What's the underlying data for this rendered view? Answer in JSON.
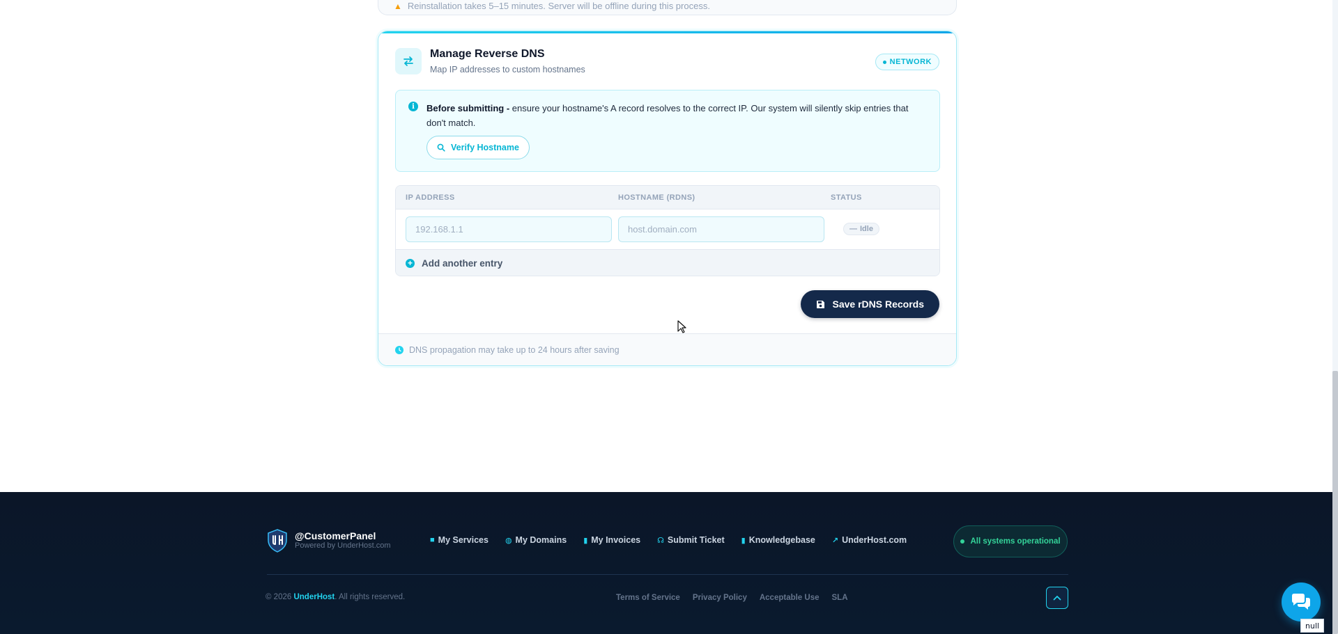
{
  "previous_card": {
    "warning_text": "Reinstallation takes 5–15 minutes. Server will be offline during this process."
  },
  "rdns_card": {
    "title": "Manage Reverse DNS",
    "subtitle": "Map IP addresses to custom hostnames",
    "badge": "NETWORK",
    "info": {
      "bold": "Before submitting -",
      "text": " ensure your hostname's A record resolves to the correct IP. Our system will silently skip entries that don't match.",
      "verify_button": "Verify Hostname"
    },
    "table": {
      "headers": [
        "IP ADDRESS",
        "HOSTNAME (RDNS)",
        "STATUS"
      ],
      "row": {
        "ip_placeholder": "192.168.1.1",
        "hostname_placeholder": "host.domain.com",
        "status": "Idle"
      },
      "add_entry": "Add another entry"
    },
    "save_button": "Save rDNS Records",
    "footer_note": "DNS propagation may take up to 24 hours after saving"
  },
  "site_footer": {
    "brand_name": "@CustomerPanel",
    "brand_sub": "Powered by UnderHost.com",
    "nav": [
      {
        "label": "My Services",
        "icon": "box-icon"
      },
      {
        "label": "My Domains",
        "icon": "globe-icon"
      },
      {
        "label": "My Invoices",
        "icon": "file-icon"
      },
      {
        "label": "Submit Ticket",
        "icon": "headset-icon"
      },
      {
        "label": "Knowledgebase",
        "icon": "book-icon"
      },
      {
        "label": "UnderHost.com",
        "icon": "external-link-icon"
      }
    ],
    "status": "All systems operational",
    "copyright_prefix": "© 2026",
    "copyright_brand": "UnderHost",
    "copyright_suffix": ". All rights reserved.",
    "legal": [
      "Terms of Service",
      "Privacy Policy",
      "Acceptable Use",
      "SLA"
    ]
  },
  "chat_tooltip": "null",
  "colors": {
    "accent": "#06b6d4",
    "navy_button": "#14294a",
    "footer_bg": "#0b1628",
    "status_green": "#34d399"
  }
}
